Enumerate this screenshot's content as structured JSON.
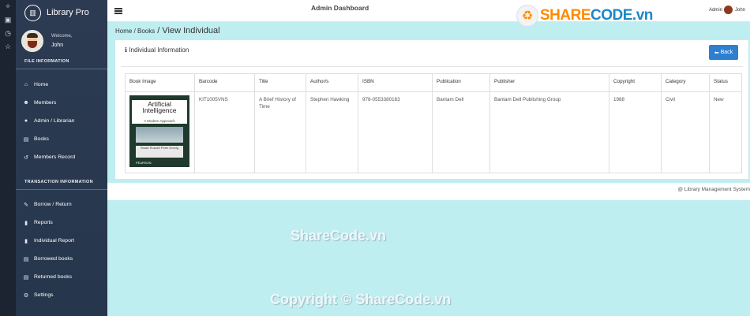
{
  "app": {
    "name": "Library Pro",
    "top_title": "Admin Dashboard"
  },
  "user": {
    "welcome": "Welcome,",
    "name": "John"
  },
  "topbar": {
    "role": "Admin",
    "user": "John"
  },
  "sidebar": {
    "section1": "FILE INFORMATION",
    "items1": [
      {
        "label": "Home",
        "icon": "home-icon"
      },
      {
        "label": "Members",
        "icon": "users-icon"
      },
      {
        "label": "Admin / Librarian",
        "icon": "user-icon"
      },
      {
        "label": "Books",
        "icon": "book-icon"
      },
      {
        "label": "Members Record",
        "icon": "history-icon"
      }
    ],
    "section2": "TRANSACTION INFORMATION",
    "items2": [
      {
        "label": "Borrow / Return",
        "icon": "edit-icon"
      },
      {
        "label": "Reports",
        "icon": "file-icon"
      },
      {
        "label": "Individual Report",
        "icon": "file-icon"
      },
      {
        "label": "Borrowed books",
        "icon": "book-icon"
      },
      {
        "label": "Returned books",
        "icon": "book-icon"
      },
      {
        "label": "Settings",
        "icon": "gear-icon"
      }
    ]
  },
  "breadcrumb": {
    "home": "Home",
    "sep1": " / ",
    "books": "Books",
    "sep2": " / ",
    "current": "View Individual"
  },
  "panel": {
    "title": "Individual Information",
    "back": "Back"
  },
  "table": {
    "headers": [
      "Book Image",
      "Barcode",
      "Title",
      "Author/s",
      "ISBN",
      "Publication",
      "Publisher",
      "Copyright",
      "Category",
      "Status"
    ],
    "row": {
      "barcode": "KIT1005VNS",
      "title": "A Brief History of Time",
      "author": "Stephen Hawking",
      "isbn": "978-0553380163",
      "publication": "Bantam Dell",
      "publisher": "Bantam Dell Publishing Group",
      "copyright": "1988",
      "category": "Civil",
      "status": "New"
    },
    "cover": {
      "title": "Artificial Intelligence",
      "subtitle": "A Modern Approach",
      "authors": "Stuart Russell Peter Norvig",
      "publisher": "PEARSON"
    }
  },
  "footer": "@ Library Management System",
  "watermarks": {
    "logo_a": "SHARE",
    "logo_b": "CODE.vn",
    "mid": "ShareCode.vn",
    "bottom": "Copyright © ShareCode.vn"
  }
}
